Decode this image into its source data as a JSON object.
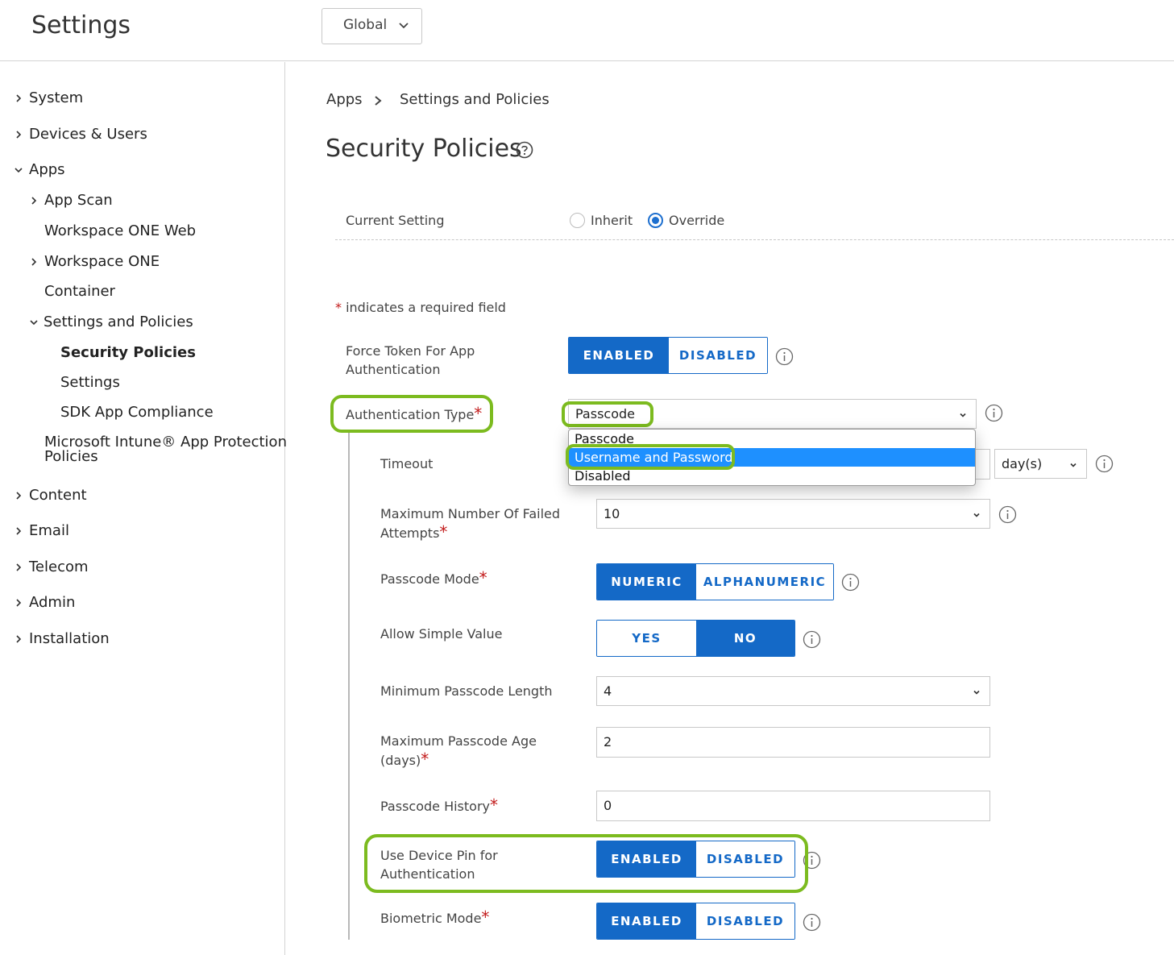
{
  "header": {
    "title": "Settings",
    "org_select": "Global"
  },
  "sidebar": {
    "items": [
      {
        "label": "System"
      },
      {
        "label": "Devices & Users"
      },
      {
        "label": "Apps"
      },
      {
        "label": "App Scan"
      },
      {
        "label": "Workspace ONE Web"
      },
      {
        "label": "Workspace ONE"
      },
      {
        "label": "Container"
      },
      {
        "label": "Settings and Policies"
      },
      {
        "label": "Security Policies"
      },
      {
        "label": "Settings"
      },
      {
        "label": "SDK App Compliance"
      },
      {
        "label": "Microsoft Intune® App Protection"
      },
      {
        "label": "Policies"
      },
      {
        "label": "Content"
      },
      {
        "label": "Email"
      },
      {
        "label": "Telecom"
      },
      {
        "label": "Admin"
      },
      {
        "label": "Installation"
      }
    ]
  },
  "breadcrumb": {
    "first": "Apps",
    "second": "Settings and Policies"
  },
  "page_title": "Security Policies",
  "current_setting": {
    "label": "Current Setting",
    "inherit": "Inherit",
    "override": "Override",
    "selected": "Override"
  },
  "required_note": "indicates a required field",
  "required_mark": "*",
  "form": {
    "force_token": {
      "label_line1": "Force Token For App",
      "label_line2": "Authentication",
      "enabled": "ENABLED",
      "disabled": "DISABLED",
      "selected": "ENABLED"
    },
    "auth_type": {
      "label": "Authentication Type",
      "value": "Passcode",
      "options": [
        "Passcode",
        "Username and Password",
        "Disabled"
      ],
      "highlighted": "Username and Password"
    },
    "timeout": {
      "label": "Timeout",
      "unit": "day(s)"
    },
    "max_failed": {
      "label_line1": "Maximum Number Of Failed",
      "label_line2": "Attempts",
      "value": "10"
    },
    "passcode_mode": {
      "label": "Passcode Mode",
      "numeric": "NUMERIC",
      "alphanumeric": "ALPHANUMERIC",
      "selected": "NUMERIC"
    },
    "simple_value": {
      "label": "Allow Simple Value",
      "yes": "YES",
      "no": "NO",
      "selected": "NO"
    },
    "min_length": {
      "label": "Minimum Passcode Length",
      "value": "4"
    },
    "max_age": {
      "label_line1": "Maximum Passcode Age",
      "label_line2": "(days)",
      "value": "2"
    },
    "history": {
      "label": "Passcode History",
      "value": "0"
    },
    "device_pin": {
      "label_line1": "Use Device Pin for",
      "label_line2": "Authentication",
      "enabled": "ENABLED",
      "disabled": "DISABLED",
      "selected": "ENABLED"
    },
    "biometric": {
      "label": "Biometric Mode",
      "enabled": "ENABLED",
      "disabled": "DISABLED",
      "selected": "ENABLED"
    }
  },
  "colors": {
    "primary": "#1469c7",
    "highlight_outline": "#7cbb1f",
    "dropdown_highlight": "#1e90ff",
    "required": "#c21b1b"
  }
}
